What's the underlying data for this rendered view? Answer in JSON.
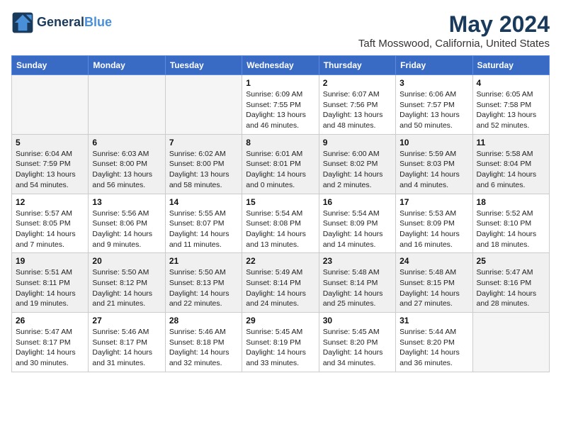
{
  "header": {
    "logo_line1": "General",
    "logo_line2": "Blue",
    "month_year": "May 2024",
    "location": "Taft Mosswood, California, United States"
  },
  "days_of_week": [
    "Sunday",
    "Monday",
    "Tuesday",
    "Wednesday",
    "Thursday",
    "Friday",
    "Saturday"
  ],
  "weeks": [
    [
      {
        "num": "",
        "info": ""
      },
      {
        "num": "",
        "info": ""
      },
      {
        "num": "",
        "info": ""
      },
      {
        "num": "1",
        "info": "Sunrise: 6:09 AM\nSunset: 7:55 PM\nDaylight: 13 hours and 46 minutes."
      },
      {
        "num": "2",
        "info": "Sunrise: 6:07 AM\nSunset: 7:56 PM\nDaylight: 13 hours and 48 minutes."
      },
      {
        "num": "3",
        "info": "Sunrise: 6:06 AM\nSunset: 7:57 PM\nDaylight: 13 hours and 50 minutes."
      },
      {
        "num": "4",
        "info": "Sunrise: 6:05 AM\nSunset: 7:58 PM\nDaylight: 13 hours and 52 minutes."
      }
    ],
    [
      {
        "num": "5",
        "info": "Sunrise: 6:04 AM\nSunset: 7:59 PM\nDaylight: 13 hours and 54 minutes."
      },
      {
        "num": "6",
        "info": "Sunrise: 6:03 AM\nSunset: 8:00 PM\nDaylight: 13 hours and 56 minutes."
      },
      {
        "num": "7",
        "info": "Sunrise: 6:02 AM\nSunset: 8:00 PM\nDaylight: 13 hours and 58 minutes."
      },
      {
        "num": "8",
        "info": "Sunrise: 6:01 AM\nSunset: 8:01 PM\nDaylight: 14 hours and 0 minutes."
      },
      {
        "num": "9",
        "info": "Sunrise: 6:00 AM\nSunset: 8:02 PM\nDaylight: 14 hours and 2 minutes."
      },
      {
        "num": "10",
        "info": "Sunrise: 5:59 AM\nSunset: 8:03 PM\nDaylight: 14 hours and 4 minutes."
      },
      {
        "num": "11",
        "info": "Sunrise: 5:58 AM\nSunset: 8:04 PM\nDaylight: 14 hours and 6 minutes."
      }
    ],
    [
      {
        "num": "12",
        "info": "Sunrise: 5:57 AM\nSunset: 8:05 PM\nDaylight: 14 hours and 7 minutes."
      },
      {
        "num": "13",
        "info": "Sunrise: 5:56 AM\nSunset: 8:06 PM\nDaylight: 14 hours and 9 minutes."
      },
      {
        "num": "14",
        "info": "Sunrise: 5:55 AM\nSunset: 8:07 PM\nDaylight: 14 hours and 11 minutes."
      },
      {
        "num": "15",
        "info": "Sunrise: 5:54 AM\nSunset: 8:08 PM\nDaylight: 14 hours and 13 minutes."
      },
      {
        "num": "16",
        "info": "Sunrise: 5:54 AM\nSunset: 8:09 PM\nDaylight: 14 hours and 14 minutes."
      },
      {
        "num": "17",
        "info": "Sunrise: 5:53 AM\nSunset: 8:09 PM\nDaylight: 14 hours and 16 minutes."
      },
      {
        "num": "18",
        "info": "Sunrise: 5:52 AM\nSunset: 8:10 PM\nDaylight: 14 hours and 18 minutes."
      }
    ],
    [
      {
        "num": "19",
        "info": "Sunrise: 5:51 AM\nSunset: 8:11 PM\nDaylight: 14 hours and 19 minutes."
      },
      {
        "num": "20",
        "info": "Sunrise: 5:50 AM\nSunset: 8:12 PM\nDaylight: 14 hours and 21 minutes."
      },
      {
        "num": "21",
        "info": "Sunrise: 5:50 AM\nSunset: 8:13 PM\nDaylight: 14 hours and 22 minutes."
      },
      {
        "num": "22",
        "info": "Sunrise: 5:49 AM\nSunset: 8:14 PM\nDaylight: 14 hours and 24 minutes."
      },
      {
        "num": "23",
        "info": "Sunrise: 5:48 AM\nSunset: 8:14 PM\nDaylight: 14 hours and 25 minutes."
      },
      {
        "num": "24",
        "info": "Sunrise: 5:48 AM\nSunset: 8:15 PM\nDaylight: 14 hours and 27 minutes."
      },
      {
        "num": "25",
        "info": "Sunrise: 5:47 AM\nSunset: 8:16 PM\nDaylight: 14 hours and 28 minutes."
      }
    ],
    [
      {
        "num": "26",
        "info": "Sunrise: 5:47 AM\nSunset: 8:17 PM\nDaylight: 14 hours and 30 minutes."
      },
      {
        "num": "27",
        "info": "Sunrise: 5:46 AM\nSunset: 8:17 PM\nDaylight: 14 hours and 31 minutes."
      },
      {
        "num": "28",
        "info": "Sunrise: 5:46 AM\nSunset: 8:18 PM\nDaylight: 14 hours and 32 minutes."
      },
      {
        "num": "29",
        "info": "Sunrise: 5:45 AM\nSunset: 8:19 PM\nDaylight: 14 hours and 33 minutes."
      },
      {
        "num": "30",
        "info": "Sunrise: 5:45 AM\nSunset: 8:20 PM\nDaylight: 14 hours and 34 minutes."
      },
      {
        "num": "31",
        "info": "Sunrise: 5:44 AM\nSunset: 8:20 PM\nDaylight: 14 hours and 36 minutes."
      },
      {
        "num": "",
        "info": ""
      }
    ]
  ]
}
